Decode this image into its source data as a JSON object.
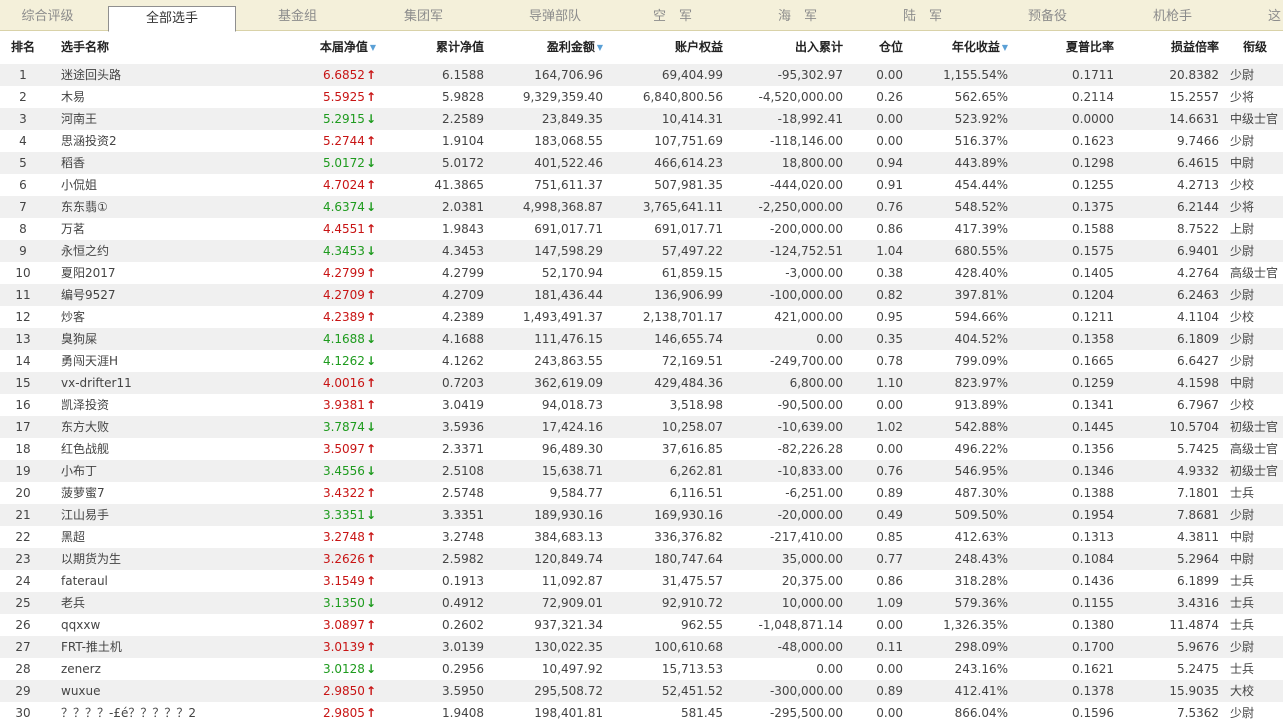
{
  "tabs": [
    {
      "label": "综合评级",
      "active": false
    },
    {
      "label": "全部选手",
      "active": true
    },
    {
      "label": "基金组",
      "active": false
    },
    {
      "label": "集团军",
      "active": false
    },
    {
      "label": "导弹部队",
      "active": false
    },
    {
      "label": "空　军",
      "active": false
    },
    {
      "label": "海　军",
      "active": false
    },
    {
      "label": "陆　军",
      "active": false
    },
    {
      "label": "预备役",
      "active": false
    },
    {
      "label": "机枪手",
      "active": false
    },
    {
      "label": "这",
      "active": false
    }
  ],
  "headers": {
    "rank": "排名",
    "name": "选手名称",
    "nav": "本届净值",
    "cum": "累计净值",
    "profit": "盈利金额",
    "equity": "账户权益",
    "io": "出入累计",
    "pos": "仓位",
    "annual": "年化收益",
    "sharpe": "夏普比率",
    "ratio": "损益倍率",
    "title": "衔级"
  },
  "sort_icon": "sort-desc-icon",
  "colors": {
    "up": "#c81414",
    "down": "#1e9b1e",
    "sort": "#5aa0d6"
  },
  "rows": [
    {
      "rank": "1",
      "name": "迷途回头路",
      "nav": "6.6852",
      "dir": "up",
      "cum": "6.1588",
      "profit": "164,706.96",
      "equity": "69,404.99",
      "io": "-95,302.97",
      "pos": "0.00",
      "annual": "1,155.54%",
      "sharpe": "0.1711",
      "ratio": "20.8382",
      "title": "少尉"
    },
    {
      "rank": "2",
      "name": "木易",
      "nav": "5.5925",
      "dir": "up",
      "cum": "5.9828",
      "profit": "9,329,359.40",
      "equity": "6,840,800.56",
      "io": "-4,520,000.00",
      "pos": "0.26",
      "annual": "562.65%",
      "sharpe": "0.2114",
      "ratio": "15.2557",
      "title": "少将"
    },
    {
      "rank": "3",
      "name": "河南王",
      "nav": "5.2915",
      "dir": "down",
      "cum": "2.2589",
      "profit": "23,849.35",
      "equity": "10,414.31",
      "io": "-18,992.41",
      "pos": "0.00",
      "annual": "523.92%",
      "sharpe": "0.0000",
      "ratio": "14.6631",
      "title": "中级士官"
    },
    {
      "rank": "4",
      "name": "思涵投资2",
      "nav": "5.2744",
      "dir": "up",
      "cum": "1.9104",
      "profit": "183,068.55",
      "equity": "107,751.69",
      "io": "-118,146.00",
      "pos": "0.00",
      "annual": "516.37%",
      "sharpe": "0.1623",
      "ratio": "9.7466",
      "title": "少尉"
    },
    {
      "rank": "5",
      "name": "稻香",
      "nav": "5.0172",
      "dir": "down",
      "cum": "5.0172",
      "profit": "401,522.46",
      "equity": "466,614.23",
      "io": "18,800.00",
      "pos": "0.94",
      "annual": "443.89%",
      "sharpe": "0.1298",
      "ratio": "6.4615",
      "title": "中尉"
    },
    {
      "rank": "6",
      "name": "小侃姐",
      "nav": "4.7024",
      "dir": "up",
      "cum": "41.3865",
      "profit": "751,611.37",
      "equity": "507,981.35",
      "io": "-444,020.00",
      "pos": "0.91",
      "annual": "454.44%",
      "sharpe": "0.1255",
      "ratio": "4.2713",
      "title": "少校"
    },
    {
      "rank": "7",
      "name": "东东翡①",
      "nav": "4.6374",
      "dir": "down",
      "cum": "2.0381",
      "profit": "4,998,368.87",
      "equity": "3,765,641.11",
      "io": "-2,250,000.00",
      "pos": "0.76",
      "annual": "548.52%",
      "sharpe": "0.1375",
      "ratio": "6.2144",
      "title": "少将"
    },
    {
      "rank": "8",
      "name": "万茗",
      "nav": "4.4551",
      "dir": "up",
      "cum": "1.9843",
      "profit": "691,017.71",
      "equity": "691,017.71",
      "io": "-200,000.00",
      "pos": "0.86",
      "annual": "417.39%",
      "sharpe": "0.1588",
      "ratio": "8.7522",
      "title": "上尉"
    },
    {
      "rank": "9",
      "name": "永恒之约",
      "nav": "4.3453",
      "dir": "down",
      "cum": "4.3453",
      "profit": "147,598.29",
      "equity": "57,497.22",
      "io": "-124,752.51",
      "pos": "1.04",
      "annual": "680.55%",
      "sharpe": "0.1575",
      "ratio": "6.9401",
      "title": "少尉"
    },
    {
      "rank": "10",
      "name": "夏阳2017",
      "nav": "4.2799",
      "dir": "up",
      "cum": "4.2799",
      "profit": "52,170.94",
      "equity": "61,859.15",
      "io": "-3,000.00",
      "pos": "0.38",
      "annual": "428.40%",
      "sharpe": "0.1405",
      "ratio": "4.2764",
      "title": "高级士官"
    },
    {
      "rank": "11",
      "name": "编号9527",
      "nav": "4.2709",
      "dir": "up",
      "cum": "4.2709",
      "profit": "181,436.44",
      "equity": "136,906.99",
      "io": "-100,000.00",
      "pos": "0.82",
      "annual": "397.81%",
      "sharpe": "0.1204",
      "ratio": "6.2463",
      "title": "少尉"
    },
    {
      "rank": "12",
      "name": "炒客",
      "nav": "4.2389",
      "dir": "up",
      "cum": "4.2389",
      "profit": "1,493,491.37",
      "equity": "2,138,701.17",
      "io": "421,000.00",
      "pos": "0.95",
      "annual": "594.66%",
      "sharpe": "0.1211",
      "ratio": "4.1104",
      "title": "少校"
    },
    {
      "rank": "13",
      "name": "臭狗屎",
      "nav": "4.1688",
      "dir": "down",
      "cum": "4.1688",
      "profit": "111,476.15",
      "equity": "146,655.74",
      "io": "0.00",
      "pos": "0.35",
      "annual": "404.52%",
      "sharpe": "0.1358",
      "ratio": "6.1809",
      "title": "少尉"
    },
    {
      "rank": "14",
      "name": "勇闯天涯H",
      "nav": "4.1262",
      "dir": "down",
      "cum": "4.1262",
      "profit": "243,863.55",
      "equity": "72,169.51",
      "io": "-249,700.00",
      "pos": "0.78",
      "annual": "799.09%",
      "sharpe": "0.1665",
      "ratio": "6.6427",
      "title": "少尉"
    },
    {
      "rank": "15",
      "name": "vx-drifter11",
      "nav": "4.0016",
      "dir": "up",
      "cum": "0.7203",
      "profit": "362,619.09",
      "equity": "429,484.36",
      "io": "6,800.00",
      "pos": "1.10",
      "annual": "823.97%",
      "sharpe": "0.1259",
      "ratio": "4.1598",
      "title": "中尉"
    },
    {
      "rank": "16",
      "name": "凯泽投资",
      "nav": "3.9381",
      "dir": "up",
      "cum": "3.0419",
      "profit": "94,018.73",
      "equity": "3,518.98",
      "io": "-90,500.00",
      "pos": "0.00",
      "annual": "913.89%",
      "sharpe": "0.1341",
      "ratio": "6.7967",
      "title": "少校"
    },
    {
      "rank": "17",
      "name": "东方大败",
      "nav": "3.7874",
      "dir": "down",
      "cum": "3.5936",
      "profit": "17,424.16",
      "equity": "10,258.07",
      "io": "-10,639.00",
      "pos": "1.02",
      "annual": "542.88%",
      "sharpe": "0.1445",
      "ratio": "10.5704",
      "title": "初级士官"
    },
    {
      "rank": "18",
      "name": "红色战舰",
      "nav": "3.5097",
      "dir": "up",
      "cum": "2.3371",
      "profit": "96,489.30",
      "equity": "37,616.85",
      "io": "-82,226.28",
      "pos": "0.00",
      "annual": "496.22%",
      "sharpe": "0.1356",
      "ratio": "5.7425",
      "title": "高级士官"
    },
    {
      "rank": "19",
      "name": "小布丁",
      "nav": "3.4556",
      "dir": "down",
      "cum": "2.5108",
      "profit": "15,638.71",
      "equity": "6,262.81",
      "io": "-10,833.00",
      "pos": "0.76",
      "annual": "546.95%",
      "sharpe": "0.1346",
      "ratio": "4.9332",
      "title": "初级士官"
    },
    {
      "rank": "20",
      "name": "菠萝蜜7",
      "nav": "3.4322",
      "dir": "up",
      "cum": "2.5748",
      "profit": "9,584.77",
      "equity": "6,116.51",
      "io": "-6,251.00",
      "pos": "0.89",
      "annual": "487.30%",
      "sharpe": "0.1388",
      "ratio": "7.1801",
      "title": "士兵"
    },
    {
      "rank": "21",
      "name": "江山易手",
      "nav": "3.3351",
      "dir": "down",
      "cum": "3.3351",
      "profit": "189,930.16",
      "equity": "169,930.16",
      "io": "-20,000.00",
      "pos": "0.49",
      "annual": "509.50%",
      "sharpe": "0.1954",
      "ratio": "7.8681",
      "title": "少尉"
    },
    {
      "rank": "22",
      "name": "黑超",
      "nav": "3.2748",
      "dir": "up",
      "cum": "3.2748",
      "profit": "384,683.13",
      "equity": "336,376.82",
      "io": "-217,410.00",
      "pos": "0.85",
      "annual": "412.63%",
      "sharpe": "0.1313",
      "ratio": "4.3811",
      "title": "中尉"
    },
    {
      "rank": "23",
      "name": "以期货为生",
      "nav": "3.2626",
      "dir": "up",
      "cum": "2.5982",
      "profit": "120,849.74",
      "equity": "180,747.64",
      "io": "35,000.00",
      "pos": "0.77",
      "annual": "248.43%",
      "sharpe": "0.1084",
      "ratio": "5.2964",
      "title": "中尉"
    },
    {
      "rank": "24",
      "name": "fateraul",
      "nav": "3.1549",
      "dir": "up",
      "cum": "0.1913",
      "profit": "11,092.87",
      "equity": "31,475.57",
      "io": "20,375.00",
      "pos": "0.86",
      "annual": "318.28%",
      "sharpe": "0.1436",
      "ratio": "6.1899",
      "title": "士兵"
    },
    {
      "rank": "25",
      "name": "老兵",
      "nav": "3.1350",
      "dir": "down",
      "cum": "0.4912",
      "profit": "72,909.01",
      "equity": "92,910.72",
      "io": "10,000.00",
      "pos": "1.09",
      "annual": "579.36%",
      "sharpe": "0.1155",
      "ratio": "3.4316",
      "title": "士兵"
    },
    {
      "rank": "26",
      "name": "qqxxw",
      "nav": "3.0897",
      "dir": "up",
      "cum": "0.2602",
      "profit": "937,321.34",
      "equity": "962.55",
      "io": "-1,048,871.14",
      "pos": "0.00",
      "annual": "1,326.35%",
      "sharpe": "0.1380",
      "ratio": "11.4874",
      "title": "士兵"
    },
    {
      "rank": "27",
      "name": "FRT-推土机",
      "nav": "3.0139",
      "dir": "up",
      "cum": "3.0139",
      "profit": "130,022.35",
      "equity": "100,610.68",
      "io": "-48,000.00",
      "pos": "0.11",
      "annual": "298.09%",
      "sharpe": "0.1700",
      "ratio": "5.9676",
      "title": "少尉"
    },
    {
      "rank": "28",
      "name": "zenerz",
      "nav": "3.0128",
      "dir": "down",
      "cum": "0.2956",
      "profit": "10,497.92",
      "equity": "15,713.53",
      "io": "0.00",
      "pos": "0.00",
      "annual": "243.16%",
      "sharpe": "0.1621",
      "ratio": "5.2475",
      "title": "士兵"
    },
    {
      "rank": "29",
      "name": "wuxue",
      "nav": "2.9850",
      "dir": "up",
      "cum": "3.5950",
      "profit": "295,508.72",
      "equity": "52,451.52",
      "io": "-300,000.00",
      "pos": "0.89",
      "annual": "412.41%",
      "sharpe": "0.1378",
      "ratio": "15.9035",
      "title": "大校"
    },
    {
      "rank": "30",
      "name": "？？？？-£é？？？？？2",
      "nav": "2.9805",
      "dir": "up",
      "cum": "1.9408",
      "profit": "198,401.81",
      "equity": "581.45",
      "io": "-295,500.00",
      "pos": "0.00",
      "annual": "866.04%",
      "sharpe": "0.1596",
      "ratio": "7.5362",
      "title": "少尉"
    }
  ]
}
